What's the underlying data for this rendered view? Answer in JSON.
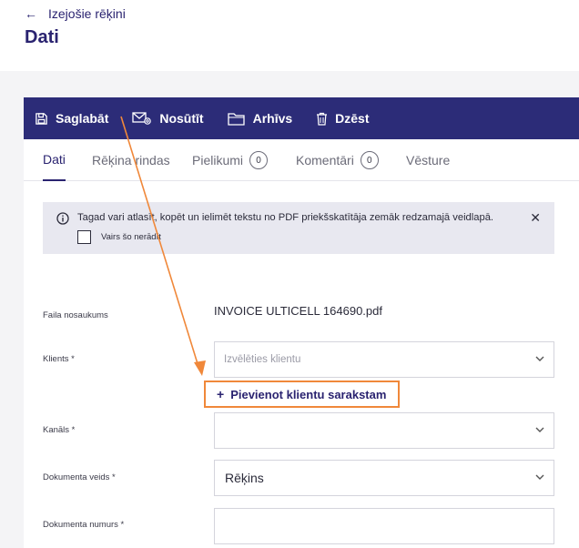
{
  "header": {
    "back_label": "Izejošie rēķini",
    "title": "Dati"
  },
  "toolbar": {
    "save_label": "Saglabāt",
    "send_label": "Nosūtīt",
    "archive_label": "Arhīvs",
    "delete_label": "Dzēst"
  },
  "tabs": [
    {
      "label": "Dati"
    },
    {
      "label": "Rēķina rindas"
    },
    {
      "label": "Pielikumi",
      "count": "0"
    },
    {
      "label": "Komentāri",
      "count": "0"
    },
    {
      "label": "Vēsture"
    }
  ],
  "notice": {
    "message": "Tagad vari atlasīt, kopēt un ielimēt tekstu no PDF priekšskatītāja zemāk redzamajā veidlapā.",
    "checkbox_label": "Vairs šo nerādīt",
    "close_symbol": "✕"
  },
  "form": {
    "file_name_label": "Faila nosaukums",
    "file_name_value": "INVOICE ULTICELL 164690.pdf",
    "client_label": "Klients *",
    "client_placeholder": "Izvēlēties klientu",
    "add_client_label": "Pievienot klientu sarakstam",
    "channel_label": "Kanāls *",
    "doc_type_label": "Dokumenta veids *",
    "doc_type_value": "Rēķins",
    "doc_number_label": "Dokumenta numurs *"
  },
  "colors": {
    "toolbar_bg": "#2c2c78",
    "accent_text": "#2a2370",
    "annotation": "#f0883a"
  }
}
